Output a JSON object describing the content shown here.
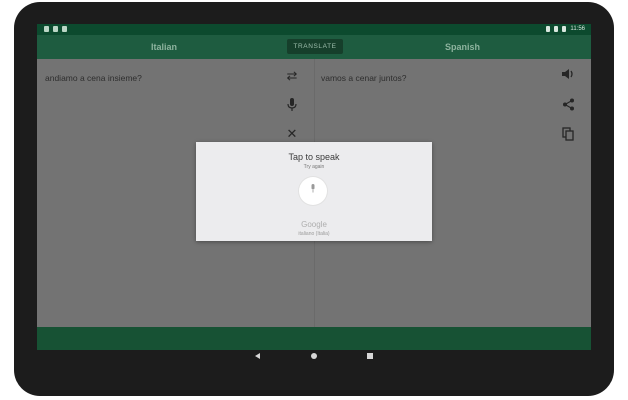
{
  "status_bar": {
    "time": "11:56"
  },
  "toolbar": {
    "source_lang": "Italian",
    "target_lang": "Spanish",
    "translate_label": "TRANSLATE"
  },
  "source": {
    "text": "andiamo a cena insieme?"
  },
  "target": {
    "text": "vamos a cenar juntos?"
  },
  "icons": {
    "swap": "swap-icon",
    "mic": "microphone-icon",
    "clear": "close-icon",
    "speaker": "volume-icon",
    "share": "share-icon",
    "copy": "copy-icon"
  },
  "speech_dialog": {
    "title": "Tap to speak",
    "subtitle": "Try again",
    "provider": "Google",
    "language": "italiano (Italia)"
  },
  "colors": {
    "accent": "#1e5c40",
    "status_bar": "#0c4a2e",
    "bottom_bar": "#175234"
  }
}
